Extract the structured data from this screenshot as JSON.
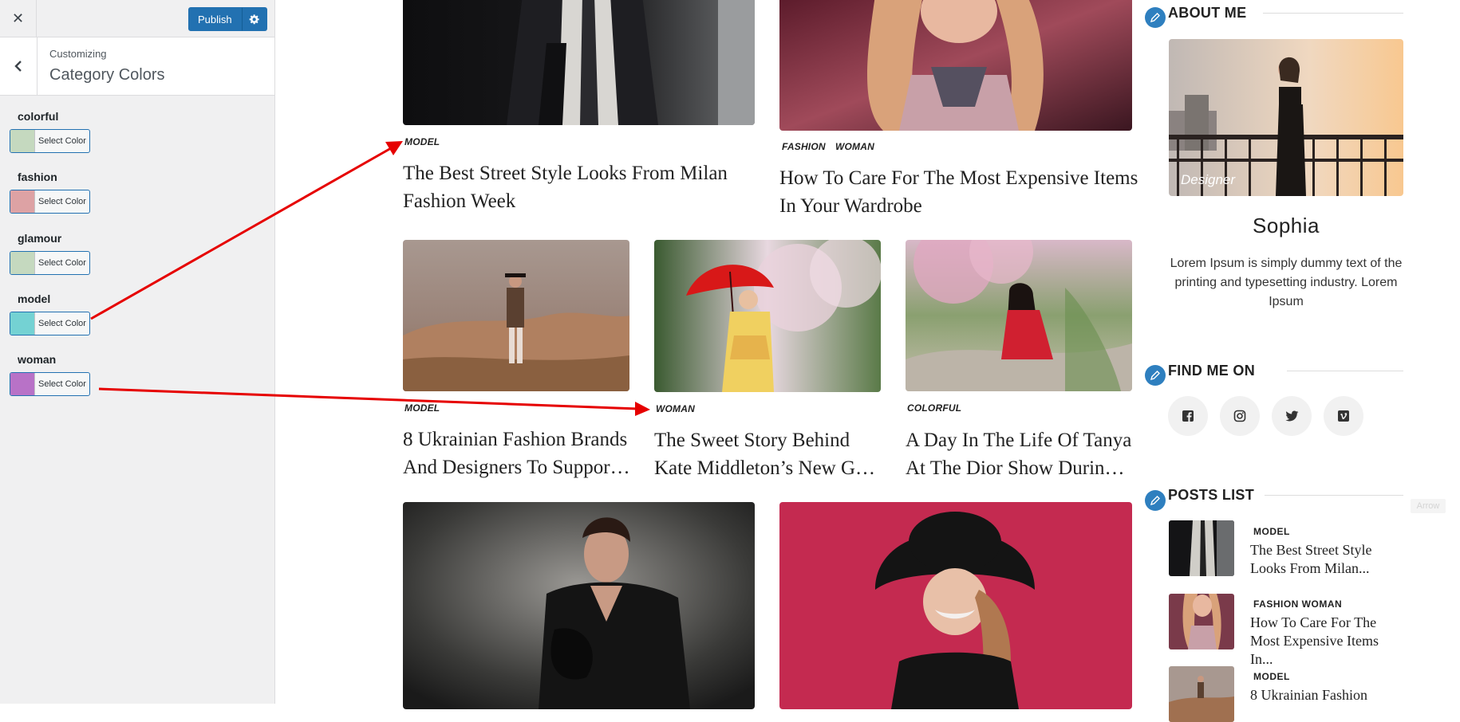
{
  "customizer": {
    "close_icon": "close-icon",
    "publish_label": "Publish",
    "settings_icon": "gear-icon",
    "back_icon": "chevron-left-icon",
    "customizing_label": "Customizing",
    "section_title": "Category Colors",
    "controls": [
      {
        "label": "colorful",
        "button": "Select Color",
        "color": "#c5d9bf"
      },
      {
        "label": "fashion",
        "button": "Select Color",
        "color": "#dda2a4"
      },
      {
        "label": "glamour",
        "button": "Select Color",
        "color": "#c5d9bf"
      },
      {
        "label": "model",
        "button": "Select Color",
        "color": "#74d2d3"
      },
      {
        "label": "woman",
        "button": "Select Color",
        "color": "#b872c7"
      }
    ]
  },
  "posts": {
    "featured": [
      {
        "tags": [
          "MODEL"
        ],
        "tag_colors": [
          "#74d2d3"
        ],
        "title": "The Best Street Style Looks From Milan Fashion Week"
      },
      {
        "tags": [
          "FASHION",
          "WOMAN"
        ],
        "tag_colors": [
          "#dda2a4",
          "#b872c7"
        ],
        "title": "How To Care For The Most Expensive Items In Your Wardrobe"
      }
    ],
    "grid": [
      {
        "tag": "MODEL",
        "tag_color": "#74d2d3",
        "title_line1": "8 Ukrainian Fashion Brands",
        "title_line2": "And Designers To Support During War"
      },
      {
        "tag": "WOMAN",
        "tag_color": "#b872c7",
        "title_line1": "The Sweet Story Behind",
        "title_line2": "Kate Middleton’s New Golden Necklace"
      },
      {
        "tag": "COLORFUL",
        "tag_color": "#c5d9bf",
        "title_line1": "A Day In The Life Of Tanya",
        "title_line2": "At The Dior Show During Fashion Week"
      }
    ]
  },
  "sidebar": {
    "about": {
      "title": "ABOUT ME",
      "image_caption": "Designer",
      "name": "Sophia",
      "bio": "Lorem Ipsum is simply dummy text of the printing and typesetting industry. Lorem Ipsum"
    },
    "find_me": {
      "title": "FIND ME ON",
      "icons": [
        "facebook-icon",
        "instagram-icon",
        "twitter-icon",
        "vimeo-icon"
      ]
    },
    "posts_list": {
      "title": "POSTS LIST",
      "items": [
        {
          "category": "MODEL",
          "title": "The Best Street Style Looks From Milan..."
        },
        {
          "category": "FASHION WOMAN",
          "title": "How To Care For The Most Expensive Items In..."
        },
        {
          "category": "MODEL",
          "title": "8 Ukrainian Fashion"
        }
      ]
    },
    "widget_icon": "pencil-icon"
  },
  "overlay": {
    "arrow_color": "#e60000",
    "faint_label": "Arrow"
  }
}
